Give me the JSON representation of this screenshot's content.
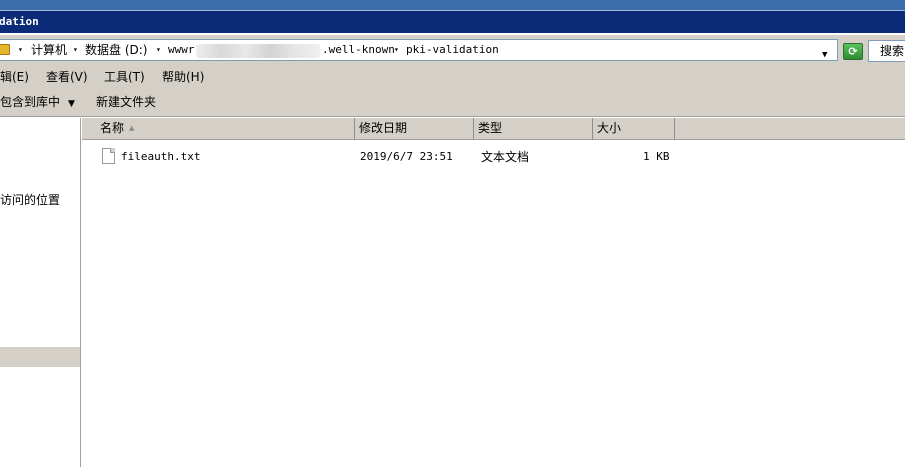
{
  "window": {
    "title": "dation"
  },
  "address": {
    "segments": [
      "计算机",
      "数据盘 (D:)",
      "wwwr",
      ".well-known",
      "pki-validation"
    ]
  },
  "search": {
    "label": "搜索"
  },
  "menu": {
    "items": [
      "辑(E)",
      "查看(V)",
      "工具(T)",
      "帮助(H)"
    ]
  },
  "toolbar": {
    "include_label": "包含到库中",
    "new_folder_label": "新建文件夹"
  },
  "nav": {
    "items": [
      "访问的位置"
    ]
  },
  "columns": {
    "name": "名称",
    "date": "修改日期",
    "type": "类型",
    "size": "大小"
  },
  "files": [
    {
      "name": "fileauth.txt",
      "date": "2019/6/7 23:51",
      "type": "文本文档",
      "size": "1 KB"
    }
  ],
  "icons": {
    "folder": "folder-icon",
    "refresh": "refresh-icon",
    "file": "text-file-icon",
    "sort": "sort-up-icon"
  }
}
